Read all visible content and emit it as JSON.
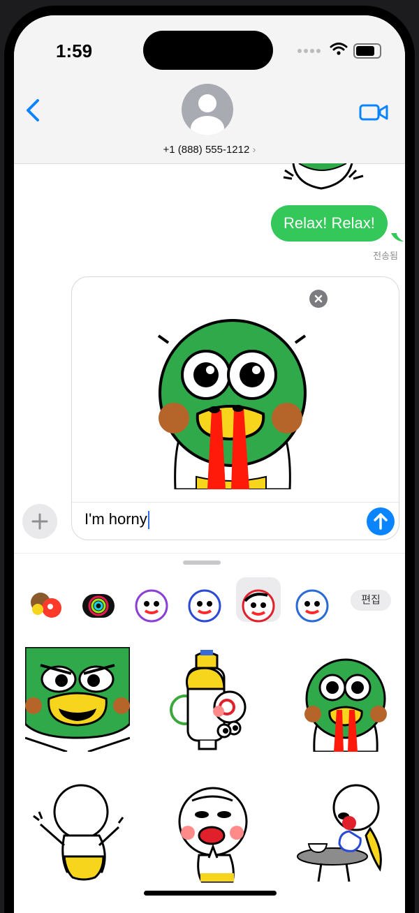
{
  "status_bar": {
    "time": "1:59"
  },
  "nav": {
    "contact": "+1 (888) 555-1212",
    "chevron": "›"
  },
  "messages": [
    {
      "text": "Relax! Relax!",
      "status": "전송됨"
    }
  ],
  "compose": {
    "text": "I'm horny"
  },
  "sticker_drawer": {
    "edit_label": "편집",
    "packs": [
      "pack-1",
      "activity",
      "pack-3",
      "pack-4",
      "pack-5-selected",
      "pack-6"
    ]
  },
  "colors": {
    "accent": "#0a84ff",
    "bubble_green": "#34c759",
    "sticker_green": "#2fa94a",
    "sticker_yellow": "#f7d51d",
    "sticker_red": "#ff1a0a"
  },
  "icons": [
    "back-chevron-icon",
    "video-camera-icon",
    "remove-icon",
    "plus-icon",
    "send-arrow-icon"
  ]
}
